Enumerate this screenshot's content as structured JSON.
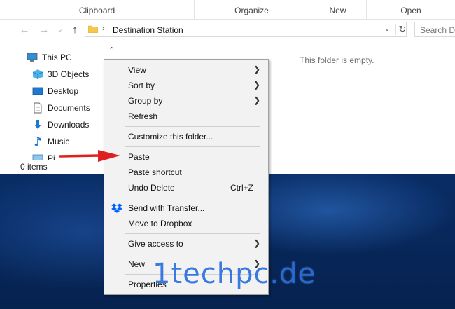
{
  "ribbon": {
    "groups": [
      "Clipboard",
      "Organize",
      "New",
      "Open"
    ]
  },
  "address": {
    "path": "Destination Station",
    "search_placeholder": "Search De"
  },
  "nav_pane": {
    "items": [
      {
        "label": "This PC",
        "icon": "this-pc-icon"
      },
      {
        "label": "3D Objects",
        "icon": "3d-objects-icon"
      },
      {
        "label": "Desktop",
        "icon": "desktop-icon"
      },
      {
        "label": "Documents",
        "icon": "documents-icon"
      },
      {
        "label": "Downloads",
        "icon": "downloads-icon"
      },
      {
        "label": "Music",
        "icon": "music-icon"
      },
      {
        "label": "Pi",
        "icon": "pictures-icon"
      }
    ]
  },
  "content": {
    "empty_message": "This folder is empty."
  },
  "status": {
    "item_count": "0 items"
  },
  "context_menu": {
    "view": "View",
    "sort_by": "Sort by",
    "group_by": "Group by",
    "refresh": "Refresh",
    "customize": "Customize this folder...",
    "paste": "Paste",
    "paste_shortcut": "Paste shortcut",
    "undo_delete": "Undo Delete",
    "undo_delete_shortcut": "Ctrl+Z",
    "send_transfer": "Send with Transfer...",
    "move_dropbox": "Move to Dropbox",
    "give_access": "Give access to",
    "new": "New",
    "properties": "Properties"
  },
  "watermark": "1techpc.de",
  "colors": {
    "accent_red": "#e02020",
    "dropbox_blue": "#0061fe",
    "folder_yellow": "#f5c84c",
    "watermark_blue": "#2a6fe0"
  }
}
